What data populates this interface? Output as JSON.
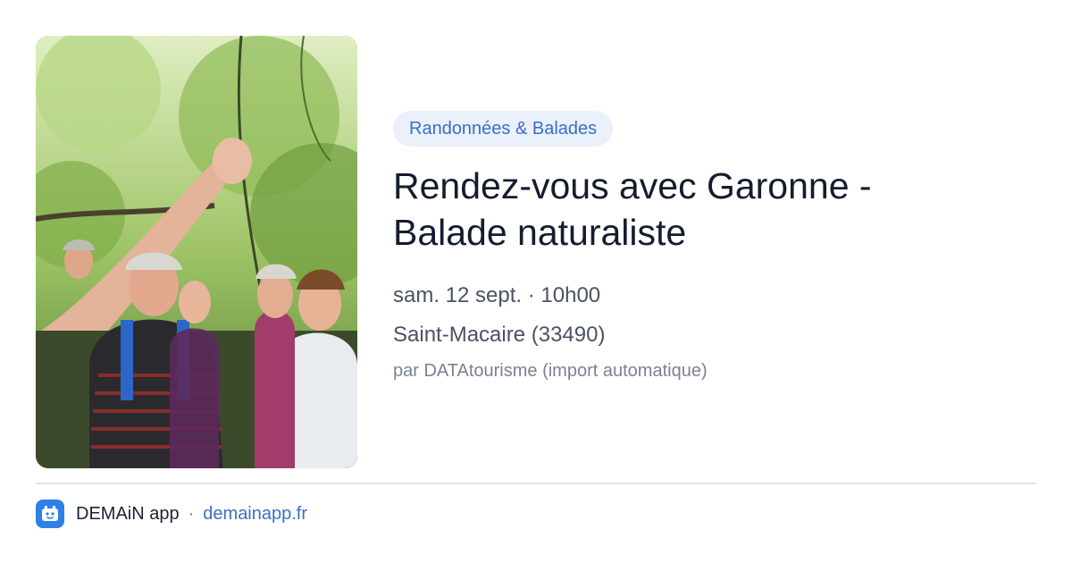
{
  "event": {
    "category": "Randonnées & Balades",
    "title": "Rendez-vous avec Garonne - Balade naturaliste",
    "date": "sam. 12 sept. · 10h00",
    "location": "Saint-Macaire (33490)",
    "source": "par DATAtourisme (import automatique)"
  },
  "footer": {
    "app_name": "DEMAiN app",
    "separator": "·",
    "link": "demainapp.fr"
  },
  "colors": {
    "accent": "#3a6fc4",
    "badge_bg": "#eaf1fb",
    "app_icon_bg": "#2f7fe6"
  },
  "icons": {
    "app": "demain-app-icon"
  }
}
